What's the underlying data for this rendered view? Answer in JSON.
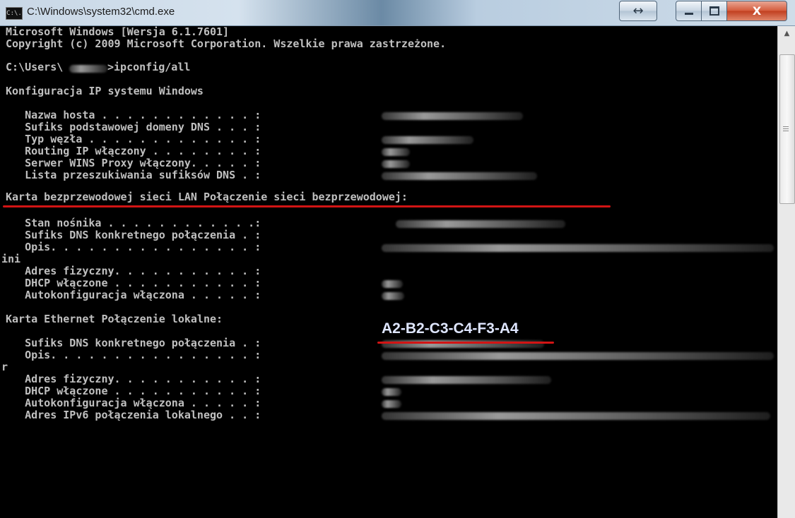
{
  "window": {
    "title": "C:\\Windows\\system32\\cmd.exe",
    "icon": "cmd-app-icon",
    "icon_label": "C:\\.",
    "buttons": {
      "resize": "↔",
      "minimize": "minimize-icon",
      "maximize": "maximize-icon",
      "close": "X"
    }
  },
  "console": {
    "lines": [
      "Microsoft Windows [Wersja 6.1.7601]",
      "Copyright (c) 2009 Microsoft Corporation. Wszelkie prawa zastrzeżone.",
      "C:\\Users\\",
      ">ipconfig/all",
      "Konfiguracja IP systemu Windows",
      "   Nazwa hosta . . . . . . . . . . . . :",
      "   Sufiks podstawowej domeny DNS . . . :",
      "   Typ węzła . . . . . . . . . . . . . :",
      "   Routing IP włączony . . . . . . . . :",
      "   Serwer WINS Proxy włączony. . . . . :",
      "   Lista przeszukiwania sufiksów DNS . :",
      "Karta bezprzewodowej sieci LAN Połączenie sieci bezprzewodowej:",
      "   Stan nośnika . . . . . . . . . . . .:",
      "   Sufiks DNS konkretnego połączenia . :",
      "   Opis. . . . . . . . . . . . . . . . :",
      "ini",
      "   Adres fizyczny. . . . . . . . . . . :",
      "   DHCP włączone . . . . . . . . . . . :",
      "   Autokonfiguracja włączona . . . . . :",
      "Karta Ethernet Połączenie lokalne:",
      "   Sufiks DNS konkretnego połączenia . :",
      "   Opis. . . . . . . . . . . . . . . . :",
      "r",
      "   Adres fizyczny. . . . . . . . . . . :",
      "   DHCP włączone . . . . . . . . . . . :",
      "   Autokonfiguracja włączona . . . . . :",
      "   Adres IPv6 połączenia lokalnego . . :"
    ],
    "highlighted_mac": "A2-B2-C3-C4-F3-A4",
    "highlight_color": "#d21414"
  }
}
